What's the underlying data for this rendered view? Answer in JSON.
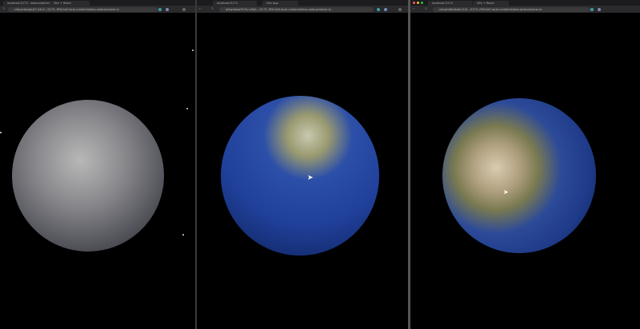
{
  "windows": [
    {
      "tabs": [
        "localhost:5173 - webcontainer",
        "Vite + React"
      ],
      "url": "c4ayzrtwnginji7-o3c3---5173--f59c0a5.local-credentialless.webcontainer.io",
      "globe": "cloud-covered earth"
    },
    {
      "tabs": [
        "localhost:5173",
        "Vite App"
      ],
      "url": "ol4qmdaw347tu-o3q2---5173--f59c0a5.local-credentialless.webcontainer.io",
      "globe": "blue earth indian ocean"
    },
    {
      "tabs": [
        "localhost:5173",
        "Vite + React"
      ],
      "url": "o4ow0a6u0bwf-v14i---5173--f59c0a5.local-credentialless.webcontainer.io",
      "globe": "earth africa europe"
    }
  ],
  "colors": {
    "background": "#000000",
    "ocean": "#1f3d8f",
    "land": "#8a8a60"
  }
}
